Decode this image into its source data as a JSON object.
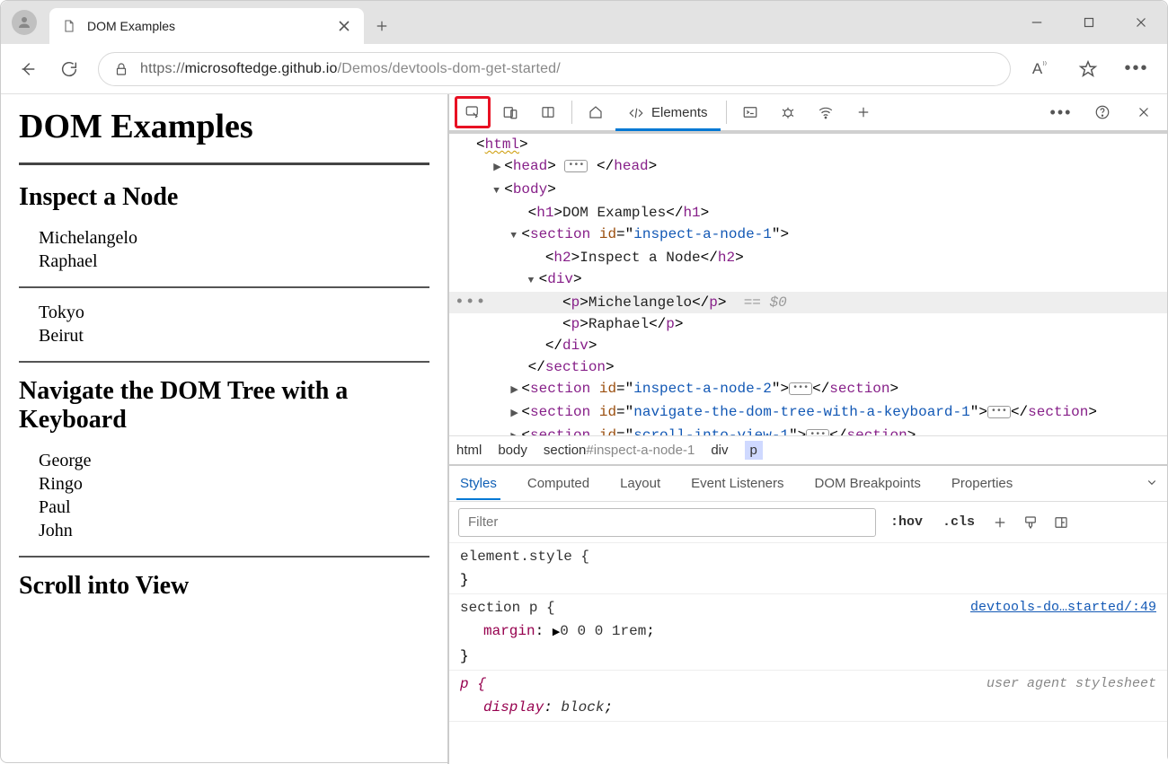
{
  "browser": {
    "tab_title": "DOM Examples",
    "url_proto": "https://",
    "url_host": "microsoftedge.github.io",
    "url_path": "/Demos/devtools-dom-get-started/"
  },
  "page": {
    "h1": "DOM Examples",
    "s1_h2": "Inspect a Node",
    "s1_items": [
      "Michelangelo",
      "Raphael"
    ],
    "s1b_items": [
      "Tokyo",
      "Beirut"
    ],
    "s2_h2": "Navigate the DOM Tree with a Keyboard",
    "s2_items": [
      "George",
      "Ringo",
      "Paul",
      "John"
    ],
    "s3_h2": "Scroll into View"
  },
  "devtools": {
    "tab_elements": "Elements",
    "breadcrumb": [
      "html",
      "body",
      "section#inspect-a-node-1",
      "div",
      "p"
    ],
    "styles_tabs": [
      "Styles",
      "Computed",
      "Layout",
      "Event Listeners",
      "DOM Breakpoints",
      "Properties"
    ],
    "filter_placeholder": "Filter",
    "hov": ":hov",
    "cls": ".cls",
    "rule_element": "element.style {",
    "rule_sectionp": "section p {",
    "rule_sectionp_prop_name": "margin",
    "rule_sectionp_prop_val": "0 0 0 1rem",
    "rule_sectionp_src": "devtools-do…started/:49",
    "rule_p": "p {",
    "rule_p_prop_name": "display",
    "rule_p_prop_val": "block",
    "rule_p_ua": "user agent stylesheet",
    "close_brace": "}"
  },
  "dom": {
    "html_open": "html",
    "head": "head",
    "body": "body",
    "h1_tag": "h1",
    "h1_text": "DOM Examples",
    "section": "section",
    "id_attr": "id",
    "id1": "inspect-a-node-1",
    "id2": "inspect-a-node-2",
    "id3": "navigate-the-dom-tree-with-a-keyboard-1",
    "id4": "scroll-into-view-1",
    "h2_tag": "h2",
    "h2_text": "Inspect a Node",
    "div": "div",
    "p": "p",
    "p1_text": "Michelangelo",
    "p2_text": "Raphael",
    "var0": "== $0"
  }
}
